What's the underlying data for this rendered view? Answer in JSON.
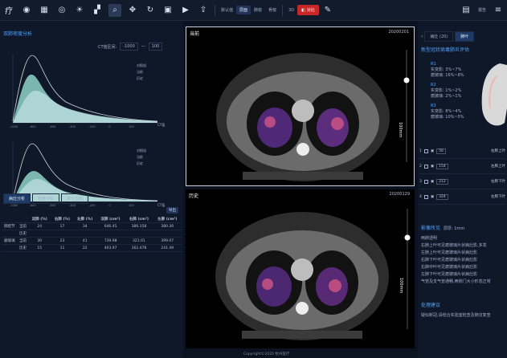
{
  "toolbar": {
    "left_cut": "疗",
    "tabs": [
      "默认值",
      "层面",
      "肺窗",
      "骨窗"
    ],
    "selected_tab": "层面",
    "mode_3d": "3D",
    "compare_label": "对比",
    "report_label": "报告"
  },
  "left_panel": {
    "title": "双肺密度分析",
    "ct_range_label": "CT值区间:",
    "ct_range_min": "-1000",
    "ct_range_max": "100",
    "axis_label": "CT值",
    "legend": [
      "对照组",
      "当前",
      "历史"
    ],
    "x_ticks": [
      "-1000",
      "-800",
      "-600",
      "-400",
      "-200",
      "0",
      "100"
    ],
    "tabs": [
      "病灶分析",
      "密度分析",
      "其它指标"
    ],
    "export_label": "导出",
    "table": {
      "headers": [
        "",
        "",
        "双肺 (%)",
        "右肺 (%)",
        "左肺 (%)",
        "双肺 (cm³)",
        "右肺 (cm³)",
        "左肺 (cm³)"
      ],
      "rows": [
        [
          "肺结节",
          "当前",
          "24",
          "17",
          "34",
          "646.45",
          "386.158",
          "380.30"
        ],
        [
          "",
          "历史",
          "",
          "",
          "",
          "",
          "",
          ""
        ],
        [
          "磨玻璃",
          "当前",
          "30",
          "23",
          "41",
          "739.98",
          "321.01",
          "399.07"
        ],
        [
          "",
          "历史",
          "15",
          "11",
          "22",
          "403.97",
          "162.478",
          "241.49"
        ]
      ]
    }
  },
  "viewers": {
    "current_label": "当前",
    "current_date": "20200201",
    "history_label": "历史",
    "history_date": "20200129",
    "scale": "100mm",
    "copyright": "Copyright©2020 杭州医疗"
  },
  "right_panel": {
    "tabs": [
      "病灶 (20)",
      "肺叶"
    ],
    "title": "新型冠状病毒肺炎评估",
    "regions": [
      {
        "name": "R1",
        "lines": [
          "实变影: 3%~7%",
          "磨玻璃: 16%~8%"
        ]
      },
      {
        "name": "R2",
        "lines": [
          "实变影: 1%~2%",
          "磨玻璃: 2%~1%"
        ]
      },
      {
        "name": "R3",
        "lines": [
          "实变影: 8%~4%",
          "磨玻璃: 10%~5%"
        ]
      }
    ],
    "lesions": [
      {
        "no": "1",
        "vol": "56",
        "lobe": "右肺上叶"
      },
      {
        "no": "2",
        "vol": "154",
        "lobe": "左肺上叶"
      },
      {
        "no": "3",
        "vol": "212",
        "lobe": "右肺下叶"
      },
      {
        "no": "4",
        "vol": "324",
        "lobe": "左肺下叶"
      }
    ],
    "findings_title": "影像所见",
    "findings_meta": "层厚: 1mm",
    "findings_lines": [
      "两肺透明",
      "右肺上叶可见磨玻璃片状病灶影,多发",
      "左肺上叶可见磨玻璃片状病灶影",
      "右肺下叶可见磨玻璃片状病灶影",
      "右肺中叶可见磨玻璃片状病灶影",
      "左肺下叶可见磨玻璃片状病灶影",
      "气管及支气管通畅,两侧门大小形态正常"
    ],
    "advice_title": "处理建议",
    "advice_text": "疑似新冠,请结合实验室检查及随访复查"
  }
}
